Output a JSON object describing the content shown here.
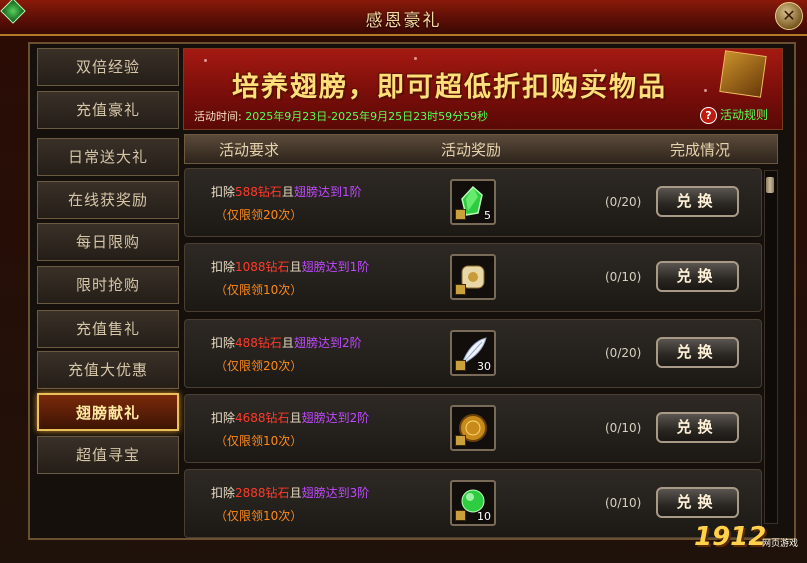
{
  "window": {
    "title": "感恩豪礼"
  },
  "sidebar": {
    "items": [
      {
        "label": "双倍经验"
      },
      {
        "label": "充值豪礼"
      },
      {
        "label": "日常送大礼"
      },
      {
        "label": "在线获奖励"
      },
      {
        "label": "每日限购"
      },
      {
        "label": "限时抢购"
      },
      {
        "label": "充值售礼"
      },
      {
        "label": "充值大优惠"
      },
      {
        "label": "翅膀献礼",
        "active": true
      },
      {
        "label": "超值寻宝"
      }
    ]
  },
  "banner": {
    "title": "培养翅膀，即可超低折扣购买物品",
    "time_label": "活动时间:",
    "time_value": "2025年9月23日-2025年9月25日23时59分59秒",
    "rules_label": "活动规则"
  },
  "table": {
    "headers": {
      "req": "活动要求",
      "reward": "活动奖励",
      "status": "完成情况"
    },
    "rows": [
      {
        "deduct": "扣除",
        "diamonds": "588钻石",
        "and": "且",
        "cond": "翅膀达到1阶",
        "limit": "（仅限领20次）",
        "reward_icon": "green-gem-icon",
        "reward_count": "5",
        "progress": "(0/20)",
        "button": "兑换"
      },
      {
        "deduct": "扣除",
        "diamonds": "1088钻石",
        "and": "且",
        "cond": "翅膀达到1阶",
        "limit": "（仅限领10次）",
        "reward_icon": "scroll-icon",
        "reward_count": "",
        "progress": "(0/10)",
        "button": "兑换"
      },
      {
        "deduct": "扣除",
        "diamonds": "488钻石",
        "and": "且",
        "cond": "翅膀达到2阶",
        "limit": "（仅限领20次）",
        "reward_icon": "feather-icon",
        "reward_count": "30",
        "progress": "(0/20)",
        "button": "兑换"
      },
      {
        "deduct": "扣除",
        "diamonds": "4688钻石",
        "and": "且",
        "cond": "翅膀达到2阶",
        "limit": "（仅限领10次）",
        "reward_icon": "gold-coin-icon",
        "reward_count": "",
        "progress": "(0/10)",
        "button": "兑换"
      },
      {
        "deduct": "扣除",
        "diamonds": "2888钻石",
        "and": "且",
        "cond": "翅膀达到3阶",
        "limit": "（仅限领10次）",
        "reward_icon": "green-orb-icon",
        "reward_count": "10",
        "progress": "(0/10)",
        "button": "兑换"
      }
    ]
  },
  "watermark": {
    "brand": "1912",
    "sub": "网页游戏"
  }
}
